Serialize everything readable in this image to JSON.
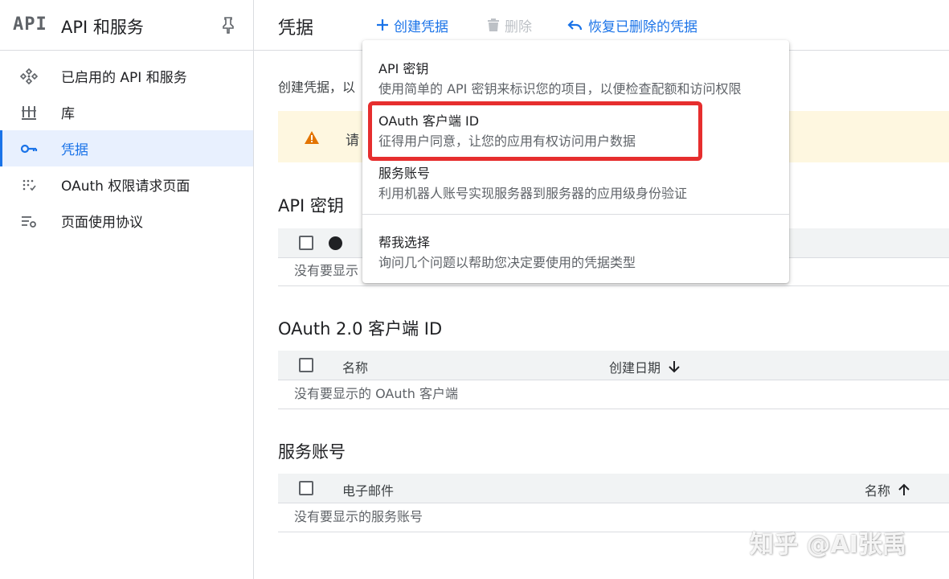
{
  "sidebar": {
    "logo": "API",
    "title": "API 和服务",
    "items": [
      {
        "label": "已启用的 API 和服务"
      },
      {
        "label": "库"
      },
      {
        "label": "凭据"
      },
      {
        "label": "OAuth 权限请求页面"
      },
      {
        "label": "页面使用协议"
      }
    ]
  },
  "toolbar": {
    "title": "凭据",
    "create_label": "创建凭据",
    "delete_label": "删除",
    "restore_label": "恢复已删除的凭据"
  },
  "main": {
    "intro": "创建凭据，以",
    "warning": "请",
    "api_keys": {
      "title": "API 密钥",
      "empty": "没有要显示"
    },
    "oauth": {
      "title": "OAuth 2.0 客户端 ID",
      "col_name": "名称",
      "col_date": "创建日期",
      "empty": "没有要显示的 OAuth 客户端"
    },
    "service_accounts": {
      "title": "服务账号",
      "col_email": "电子邮件",
      "col_name": "名称",
      "empty": "没有要显示的服务账号"
    }
  },
  "menu": {
    "items": [
      {
        "title": "API 密钥",
        "desc": "使用简单的 API 密钥来标识您的项目，以便检查配额和访问权限"
      },
      {
        "title": "OAuth 客户端 ID",
        "desc": "征得用户同意，让您的应用有权访问用户数据"
      },
      {
        "title": "服务账号",
        "desc": "利用机器人账号实现服务器到服务器的应用级身份验证"
      },
      {
        "title": "帮我选择",
        "desc": "询问几个问题以帮助您决定要使用的凭据类型"
      }
    ]
  },
  "watermark": "知乎 @AI张禹",
  "colors": {
    "accent": "#1a73e8",
    "highlight": "#e62e2e",
    "warning_bg": "#fef7e0",
    "warning_icon": "#e37400"
  }
}
